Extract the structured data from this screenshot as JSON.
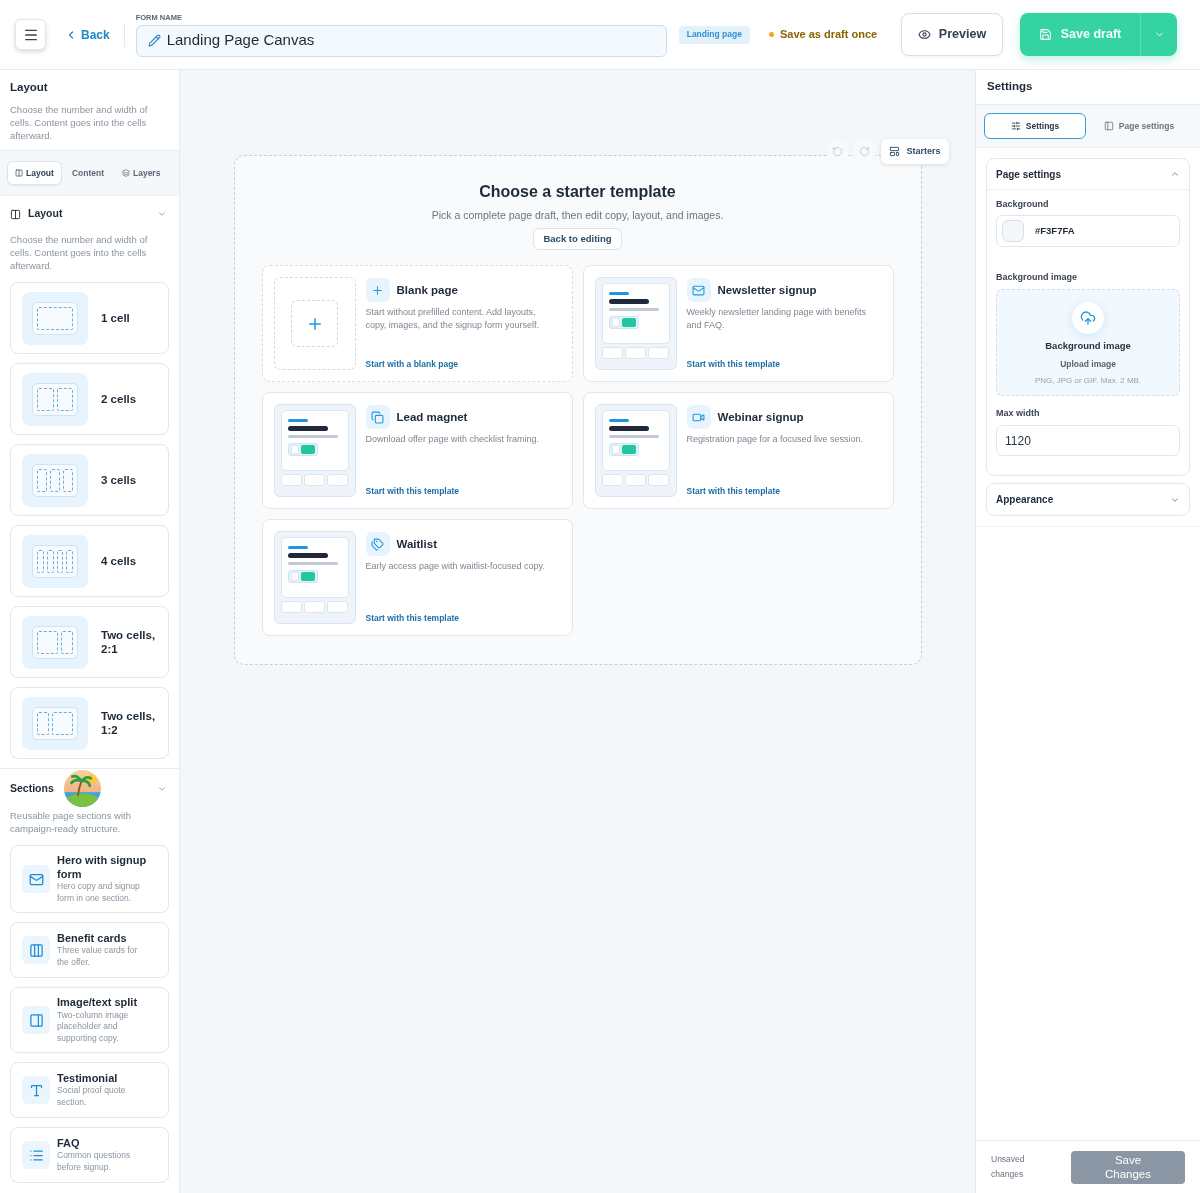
{
  "top_bar": {
    "back": "Back",
    "form_name": {
      "label": "FORM NAME",
      "value": "Landing Page Canvas"
    },
    "page_type": "Landing page",
    "draft_status": "Save as draft once",
    "preview": "Preview",
    "save_draft": "Save draft"
  },
  "left_panel": {
    "title": "Layout",
    "description": "Choose the number and width of cells. Content goes into the cells afterward.",
    "tabs": [
      {
        "label": "Layout",
        "selected": true
      },
      {
        "label": "Content",
        "selected": false
      },
      {
        "label": "Layers",
        "selected": false
      }
    ],
    "layout_group": {
      "title": "Layout",
      "description": "Choose the number and width of cells. Content goes into the cells afterward.",
      "items": [
        {
          "kind": "one",
          "label": "1 cell"
        },
        {
          "kind": "two",
          "label": "2 cells"
        },
        {
          "kind": "three",
          "label": "3 cells"
        },
        {
          "kind": "four",
          "label": "4 cells"
        },
        {
          "kind": "wide-narrow",
          "label": "Two cells, 2:1"
        },
        {
          "kind": "narrow-wide",
          "label": "Two cells, 1:2"
        }
      ]
    },
    "sections_group": {
      "title": "Sections",
      "description": "Reusable page sections with campaign-ready structure.",
      "items": [
        {
          "title": "Hero with signup form",
          "description": "Hero copy and signup form in one section."
        },
        {
          "title": "Benefit cards",
          "description": "Three value cards for the offer."
        },
        {
          "title": "Image/text split",
          "description": "Two-column image placeholder and supporting copy."
        },
        {
          "title": "Testimonial",
          "description": "Social proof quote section."
        },
        {
          "title": "FAQ",
          "description": "Common questions before signup."
        }
      ]
    }
  },
  "canvas": {
    "starters": "Starters",
    "title": "Choose a starter template",
    "subtitle": "Pick a complete page draft, then edit copy, layout, and images.",
    "back_button": "Back to editing",
    "templates": [
      {
        "kind": "blank",
        "title": "Blank page",
        "description": "Start without prefilled content. Add layouts, copy, images, and the signup form yourself.",
        "action": "Start with a blank page"
      },
      {
        "kind": "template",
        "title": "Newsletter signup",
        "description": "Weekly newsletter landing page with benefits and FAQ.",
        "action": "Start with this template"
      },
      {
        "kind": "template",
        "title": "Lead magnet",
        "description": "Download offer page with checklist framing.",
        "action": "Start with this template"
      },
      {
        "kind": "template",
        "title": "Webinar signup",
        "description": "Registration page for a focused live session.",
        "action": "Start with this template"
      },
      {
        "kind": "template",
        "title": "Waitlist",
        "description": "Early access page with waitlist-focused copy.",
        "action": "Start with this template"
      }
    ]
  },
  "right_panel": {
    "title": "Settings",
    "tabs": [
      {
        "label": "Settings",
        "selected": true
      },
      {
        "label": "Page settings",
        "selected": false
      }
    ],
    "sections": [
      {
        "title": "Page settings",
        "expanded": true,
        "fields": [
          {
            "kind": "color",
            "label": "Background",
            "value": "#F3F7FA"
          },
          {
            "kind": "upload",
            "label": "Background image",
            "title": "Background image",
            "action": "Upload image",
            "hint": "PNG, JPG or GIF. Max. 2 MB."
          },
          {
            "kind": "text",
            "label": "Max width",
            "value": "1120"
          }
        ]
      },
      {
        "title": "Appearance",
        "expanded": false
      }
    ]
  },
  "footer": {
    "status": "Unsaved changes",
    "save_button": {
      "label": "Save Changes",
      "disabled": true
    }
  }
}
